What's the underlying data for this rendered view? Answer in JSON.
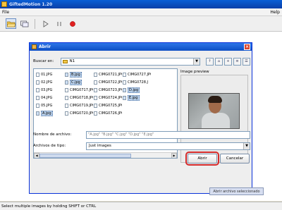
{
  "app": {
    "title": "GiftedMotion 1.20",
    "menu": {
      "file": "File",
      "help": "Help"
    }
  },
  "toolbar": {
    "icons": [
      "open-folder-icon",
      "frames-icon",
      "play-icon",
      "pause-icon",
      "record-icon"
    ],
    "record_color": "#e02020"
  },
  "dialog": {
    "title": "Abrir",
    "look_in_label": "Buscar en:",
    "look_in_value": "N1",
    "files": [
      {
        "name": "01.JPG",
        "selected": false
      },
      {
        "name": "02.JPG",
        "selected": false
      },
      {
        "name": "03.JPG",
        "selected": false
      },
      {
        "name": "04.JPG",
        "selected": false
      },
      {
        "name": "05.JPG",
        "selected": false
      },
      {
        "name": "A.jpg",
        "selected": true
      },
      {
        "name": "B.jpg",
        "selected": true
      },
      {
        "name": "C.jpg",
        "selected": true
      },
      {
        "name": "CIMG0717.JPG",
        "selected": false
      },
      {
        "name": "CIMG0718.JPG",
        "selected": false
      },
      {
        "name": "CIMG0719.JPG",
        "selected": false
      },
      {
        "name": "CIMG0720.JPG",
        "selected": false
      },
      {
        "name": "CIMG0721.JPG",
        "selected": false
      },
      {
        "name": "CIMG0722.JPG",
        "selected": false
      },
      {
        "name": "CIMG0723.JPG",
        "selected": false
      },
      {
        "name": "CIMG0724.JPG",
        "selected": false
      },
      {
        "name": "CIMG0725.JPG",
        "selected": false
      },
      {
        "name": "CIMG0726.JPG",
        "selected": false
      },
      {
        "name": "CIMG0727.JPG",
        "selected": false
      },
      {
        "name": "CIMG0728.J",
        "selected": false
      },
      {
        "name": "D.jpg",
        "selected": true
      },
      {
        "name": "E.jpg",
        "selected": true
      }
    ],
    "preview_label": "Image preview",
    "filename_label": "Nombre de archivo:",
    "filename_value": "\"A.jpg\" \"B.jpg\" \"C.jpg\" \"D.jpg\" \"E.jpg\"",
    "filetype_label": "Archivos de tipo:",
    "filetype_value": "Just images",
    "open_label": "Abrir",
    "cancel_label": "Cancelar",
    "open_tooltip": "Abrir archivo seleccionado",
    "highlight_color": "#d42a2a"
  },
  "status": {
    "text": "Select multiple images by holding SHIFT or CTRL"
  }
}
